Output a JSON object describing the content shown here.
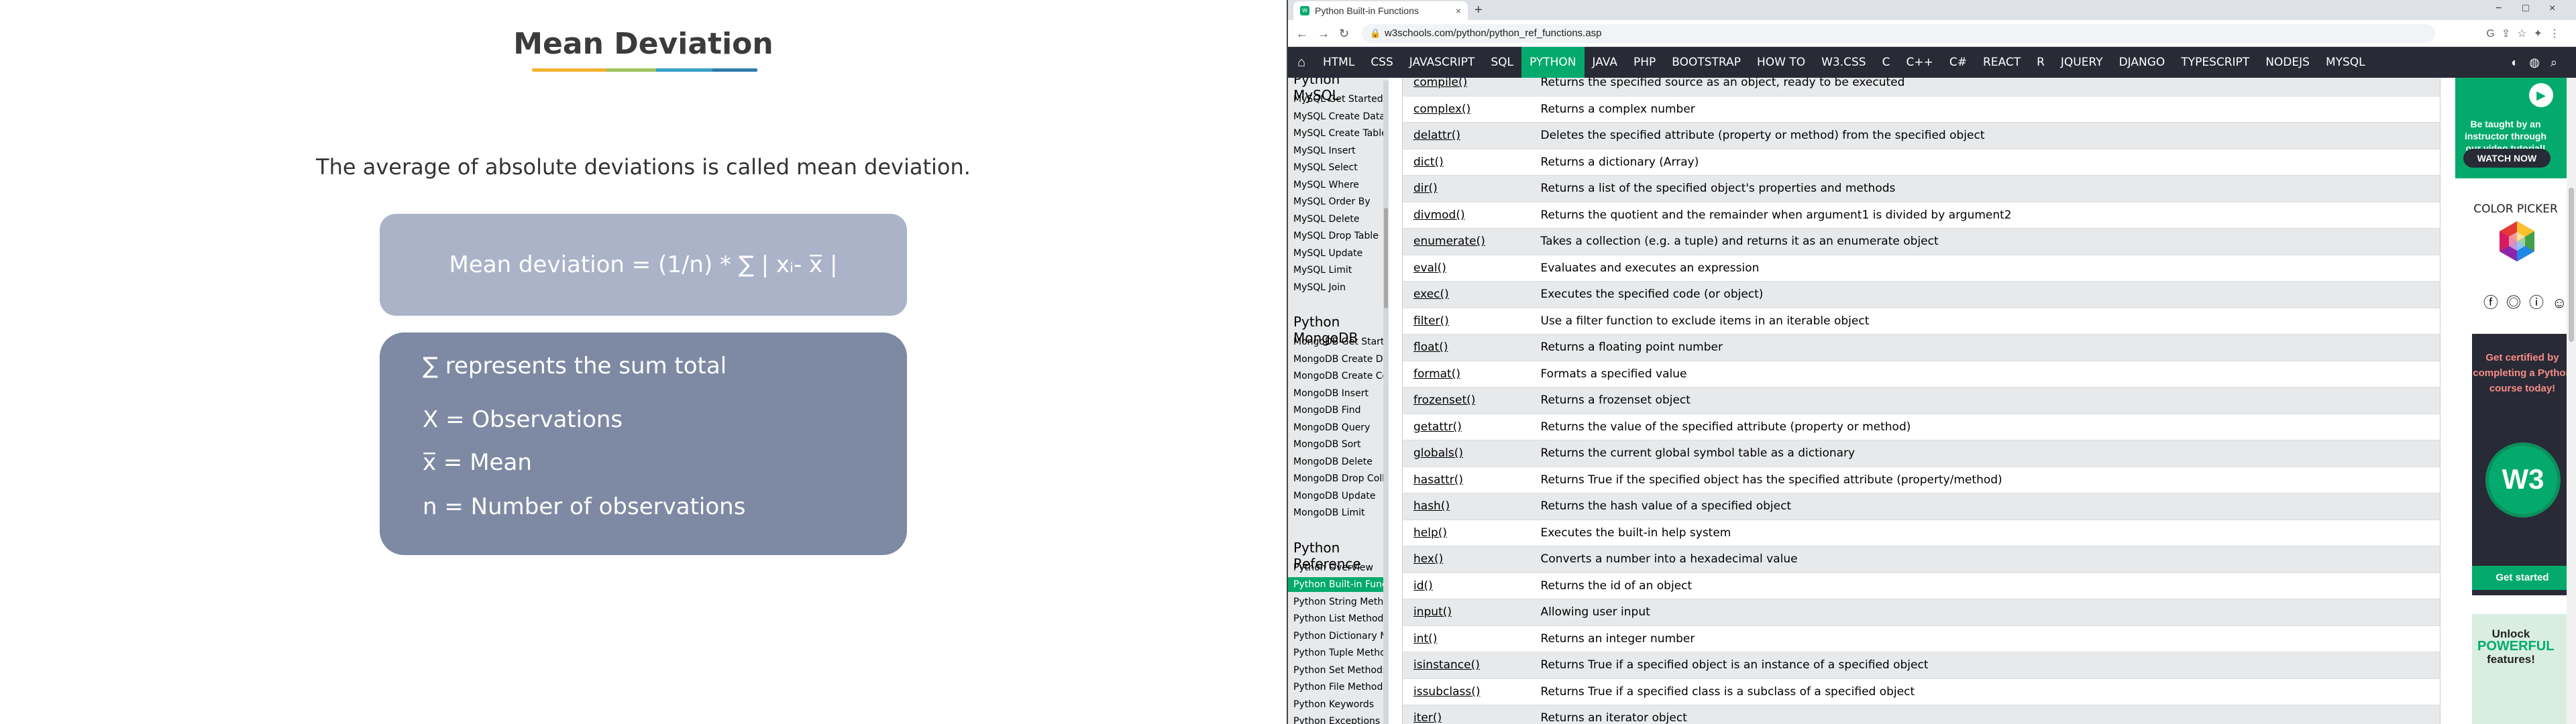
{
  "slide": {
    "title": "Mean Deviation",
    "subtitle": "The average of absolute deviations is called mean deviation.",
    "formula": "Mean deviation = (1/n) * ∑ | xᵢ- x̅ |",
    "legend": [
      "∑  represents the sum total",
      "X = Observations",
      "x̅ = Mean",
      "n = Number of observations"
    ]
  },
  "browser": {
    "tab_title": "Python Built-in Functions",
    "tab_close": "×",
    "new_tab": "+",
    "url": "w3schools.com/python/python_ref_functions.asp",
    "window_controls": [
      "−",
      "□",
      "×"
    ]
  },
  "topnav": {
    "items": [
      "HTML",
      "CSS",
      "JAVASCRIPT",
      "SQL",
      "PYTHON",
      "JAVA",
      "PHP",
      "BOOTSTRAP",
      "HOW TO",
      "W3.CSS",
      "C",
      "C++",
      "C#",
      "REACT",
      "R",
      "JQUERY",
      "DJANGO",
      "TYPESCRIPT",
      "NODEJS",
      "MYSQL"
    ],
    "active": "PYTHON"
  },
  "sidebar": {
    "sections": [
      {
        "title": "Python MySQL",
        "links": [
          "MySQL Get Started",
          "MySQL Create Database",
          "MySQL Create Table",
          "MySQL Insert",
          "MySQL Select",
          "MySQL Where",
          "MySQL Order By",
          "MySQL Delete",
          "MySQL Drop Table",
          "MySQL Update",
          "MySQL Limit",
          "MySQL Join"
        ]
      },
      {
        "title": "Python MongoDB",
        "links": [
          "MongoDB Get Started",
          "MongoDB Create Database",
          "MongoDB Create Collection",
          "MongoDB Insert",
          "MongoDB Find",
          "MongoDB Query",
          "MongoDB Sort",
          "MongoDB Delete",
          "MongoDB Drop Collection",
          "MongoDB Update",
          "MongoDB Limit"
        ]
      },
      {
        "title": "Python Reference",
        "links": [
          "Python Overview",
          "Python Built-in Functions",
          "Python String Methods",
          "Python List Methods",
          "Python Dictionary Methods",
          "Python Tuple Methods",
          "Python Set Methods",
          "Python File Methods",
          "Python Keywords",
          "Python Exceptions"
        ]
      }
    ],
    "active_link": "Python Built-in Functions"
  },
  "functions": [
    {
      "name": "compile()",
      "desc": "Returns the specified source as an object, ready to be executed"
    },
    {
      "name": "complex()",
      "desc": "Returns a complex number"
    },
    {
      "name": "delattr()",
      "desc": "Deletes the specified attribute (property or method) from the specified object"
    },
    {
      "name": "dict()",
      "desc": "Returns a dictionary (Array)"
    },
    {
      "name": "dir()",
      "desc": "Returns a list of the specified object's properties and methods"
    },
    {
      "name": "divmod()",
      "desc": "Returns the quotient and the remainder when argument1 is divided by argument2"
    },
    {
      "name": "enumerate()",
      "desc": "Takes a collection (e.g. a tuple) and returns it as an enumerate object"
    },
    {
      "name": "eval()",
      "desc": "Evaluates and executes an expression"
    },
    {
      "name": "exec()",
      "desc": "Executes the specified code (or object)"
    },
    {
      "name": "filter()",
      "desc": "Use a filter function to exclude items in an iterable object"
    },
    {
      "name": "float()",
      "desc": "Returns a floating point number"
    },
    {
      "name": "format()",
      "desc": "Formats a specified value"
    },
    {
      "name": "frozenset()",
      "desc": "Returns a frozenset object"
    },
    {
      "name": "getattr()",
      "desc": "Returns the value of the specified attribute (property or method)"
    },
    {
      "name": "globals()",
      "desc": "Returns the current global symbol table as a dictionary"
    },
    {
      "name": "hasattr()",
      "desc": "Returns True if the specified object has the specified attribute (property/method)"
    },
    {
      "name": "hash()",
      "desc": "Returns the hash value of a specified object"
    },
    {
      "name": "help()",
      "desc": "Executes the built-in help system"
    },
    {
      "name": "hex()",
      "desc": "Converts a number into a hexadecimal value"
    },
    {
      "name": "id()",
      "desc": "Returns the id of an object"
    },
    {
      "name": "input()",
      "desc": "Allowing user input"
    },
    {
      "name": "int()",
      "desc": "Returns an integer number"
    },
    {
      "name": "isinstance()",
      "desc": "Returns True if a specified object is an instance of a specified object"
    },
    {
      "name": "issubclass()",
      "desc": "Returns True if a specified class is a subclass of a specified object"
    },
    {
      "name": "iter()",
      "desc": "Returns an iterator object"
    }
  ],
  "ads": {
    "video_text": "Be taught by an instructor through our video tutorial!",
    "watch_now": "WATCH NOW",
    "color_picker": "COLOR PICKER",
    "cert_text": "Get certified by completing a Python course today!",
    "cert_badge": "W3",
    "get_started": "Get started",
    "unlock_1": "Unlock",
    "unlock_2": "POWERFUL",
    "unlock_3": "features!"
  },
  "colors": {
    "accent": "#04aa6d",
    "nav_bg": "#282a35",
    "formula_box": "#aab3c8",
    "legend_box": "#7e8aa3"
  }
}
